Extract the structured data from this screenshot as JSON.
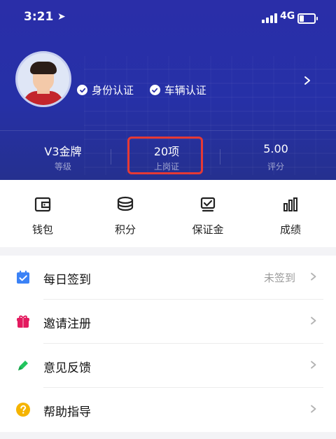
{
  "status_bar": {
    "time": "3:21",
    "network": "4G"
  },
  "profile": {
    "name": "",
    "verifications": [
      {
        "label": "身份认证"
      },
      {
        "label": "车辆认证"
      }
    ]
  },
  "stats": [
    {
      "value": "V3金牌",
      "label": "等级"
    },
    {
      "value": "20项",
      "label": "上岗证"
    },
    {
      "value": "5.00",
      "label": "评分"
    }
  ],
  "quick_actions": [
    {
      "label": "钱包",
      "icon": "wallet-icon"
    },
    {
      "label": "积分",
      "icon": "coins-icon"
    },
    {
      "label": "保证金",
      "icon": "deposit-icon"
    },
    {
      "label": "成绩",
      "icon": "bar-chart-icon"
    }
  ],
  "menu": [
    {
      "label": "每日签到",
      "right": "未签到",
      "icon": "calendar-check-icon",
      "color": "#3b82f6"
    },
    {
      "label": "邀请注册",
      "right": "",
      "icon": "gift-icon",
      "color": "#e31b5f"
    },
    {
      "label": "意见反馈",
      "right": "",
      "icon": "pencil-icon",
      "color": "#22c55e"
    },
    {
      "label": "帮助指导",
      "right": "",
      "icon": "help-icon",
      "color": "#f5b400"
    }
  ],
  "colors": {
    "header_bg": "#2a2ea8",
    "highlight": "#e53935"
  }
}
